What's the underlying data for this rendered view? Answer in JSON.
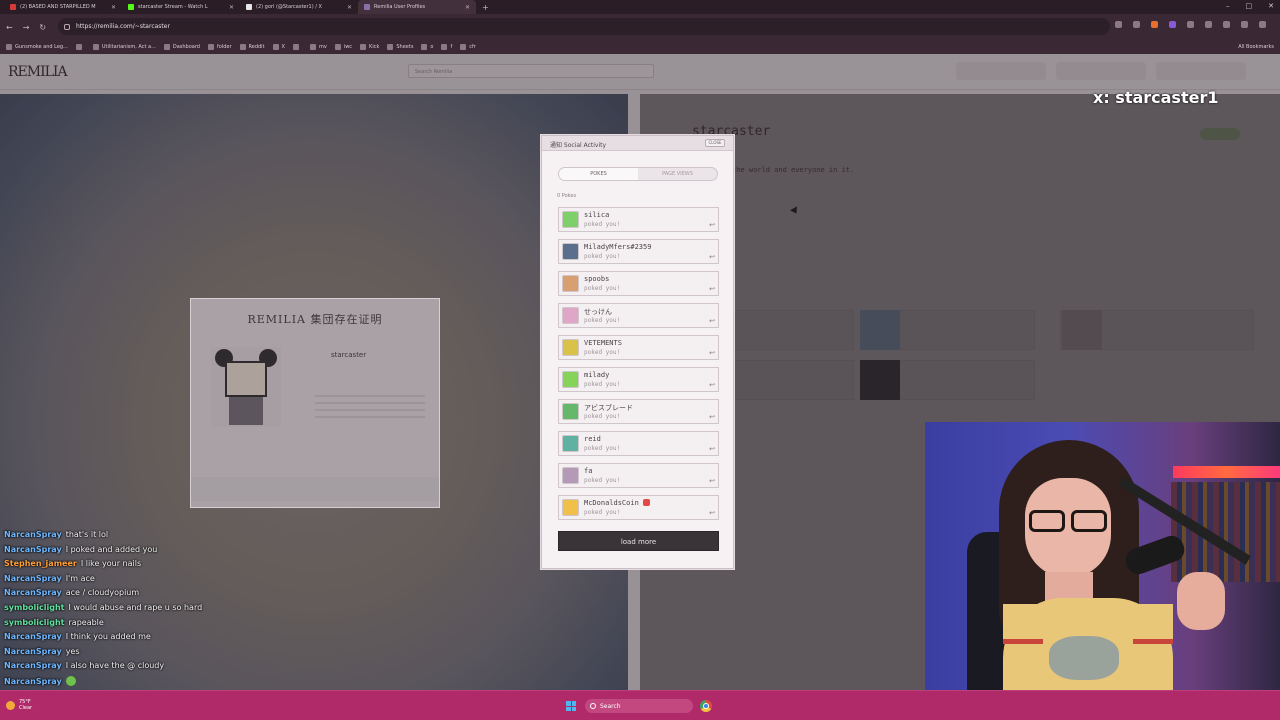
{
  "browser": {
    "tabs": [
      {
        "label": "(2) BASED AND STARPILLED M",
        "color": "#d63b3b"
      },
      {
        "label": "starcaster Stream - Watch L",
        "color": "#53fc18"
      },
      {
        "label": "(2) gorl (@Starcaster1) / X",
        "color": "#e7e7e7"
      },
      {
        "label": "Remilia User Profiles",
        "color": "#8b6fa6"
      }
    ],
    "url": "https://remilia.com/~starcaster",
    "bookmarks": [
      "Gunsmoke and Leg...",
      "",
      "Utilitarianism, Act a...",
      "Dashboard",
      "folder",
      "Reddit",
      "X",
      "",
      "mv",
      "iwc",
      "Kick",
      "Sheets",
      "o",
      "f",
      "cfr"
    ],
    "all_bookmarks": "All Bookmarks"
  },
  "site": {
    "logo": "REMILIA",
    "search_placeholder": "Search Remilia",
    "cert_title": "REMILIA 集団存在证明",
    "cert_name": "starcaster",
    "profile_name": "starcaster",
    "bio": "the world and everyone in it."
  },
  "modal": {
    "title": "通知 Social Activity",
    "close_label": "CLOSE",
    "tab_pokes": "POKES",
    "tab_page_views": "PAGE VIEWS",
    "count": "0 Pokes",
    "pokes": [
      {
        "name": "silica",
        "sub": "poked you!",
        "color": "#7fcf6a"
      },
      {
        "name": "MiladyMfers#2359",
        "sub": "poked you!",
        "color": "#5a6f8e"
      },
      {
        "name": "spoobs",
        "sub": "poked you!",
        "color": "#d8a070"
      },
      {
        "name": "せっけん",
        "sub": "poked you!",
        "color": "#e0a6c8"
      },
      {
        "name": "VETEMENTS",
        "sub": "poked you!",
        "color": "#d8c24a"
      },
      {
        "name": "milady",
        "sub": "poked you!",
        "color": "#86d35a"
      },
      {
        "name": "アビスブレード",
        "sub": "poked you!",
        "color": "#64b86a"
      },
      {
        "name": "reid",
        "sub": "poked you!",
        "color": "#5fb2a2"
      },
      {
        "name": "fa",
        "sub": "poked you!",
        "color": "#b59ab8"
      },
      {
        "name": "McDonaldsCoin",
        "sub": "poked you!",
        "color": "#f0c04a",
        "badge": true
      }
    ],
    "load_more": "load more"
  },
  "stream": {
    "x_handle": "x: starcaster1",
    "chat": [
      {
        "user": "NarcanSpray",
        "color": "#6fb8ff",
        "text": "that's it lol"
      },
      {
        "user": "NarcanSpray",
        "color": "#6fb8ff",
        "text": "I poked and added you"
      },
      {
        "user": "Stephen_jameer",
        "color": "#ff9f3a",
        "text": "I like your nails"
      },
      {
        "user": "NarcanSpray",
        "color": "#6fb8ff",
        "text": "I'm ace"
      },
      {
        "user": "NarcanSpray",
        "color": "#6fb8ff",
        "text": "ace / cloudyopium"
      },
      {
        "user": "symboliclight",
        "color": "#5fe0a0",
        "text": "I would abuse and rape u so hard"
      },
      {
        "user": "symboliclight",
        "color": "#5fe0a0",
        "text": "rapeable"
      },
      {
        "user": "NarcanSpray",
        "color": "#6fb8ff",
        "text": "I think you added me"
      },
      {
        "user": "NarcanSpray",
        "color": "#6fb8ff",
        "text": "yes"
      },
      {
        "user": "NarcanSpray",
        "color": "#6fb8ff",
        "text": "I also have the @ cloudy"
      },
      {
        "user": "NarcanSpray",
        "color": "#6fb8ff",
        "text": "",
        "emote": true
      }
    ]
  },
  "taskbar": {
    "weather_temp": "75°F",
    "weather_desc": "Clear",
    "search_label": "Search"
  }
}
